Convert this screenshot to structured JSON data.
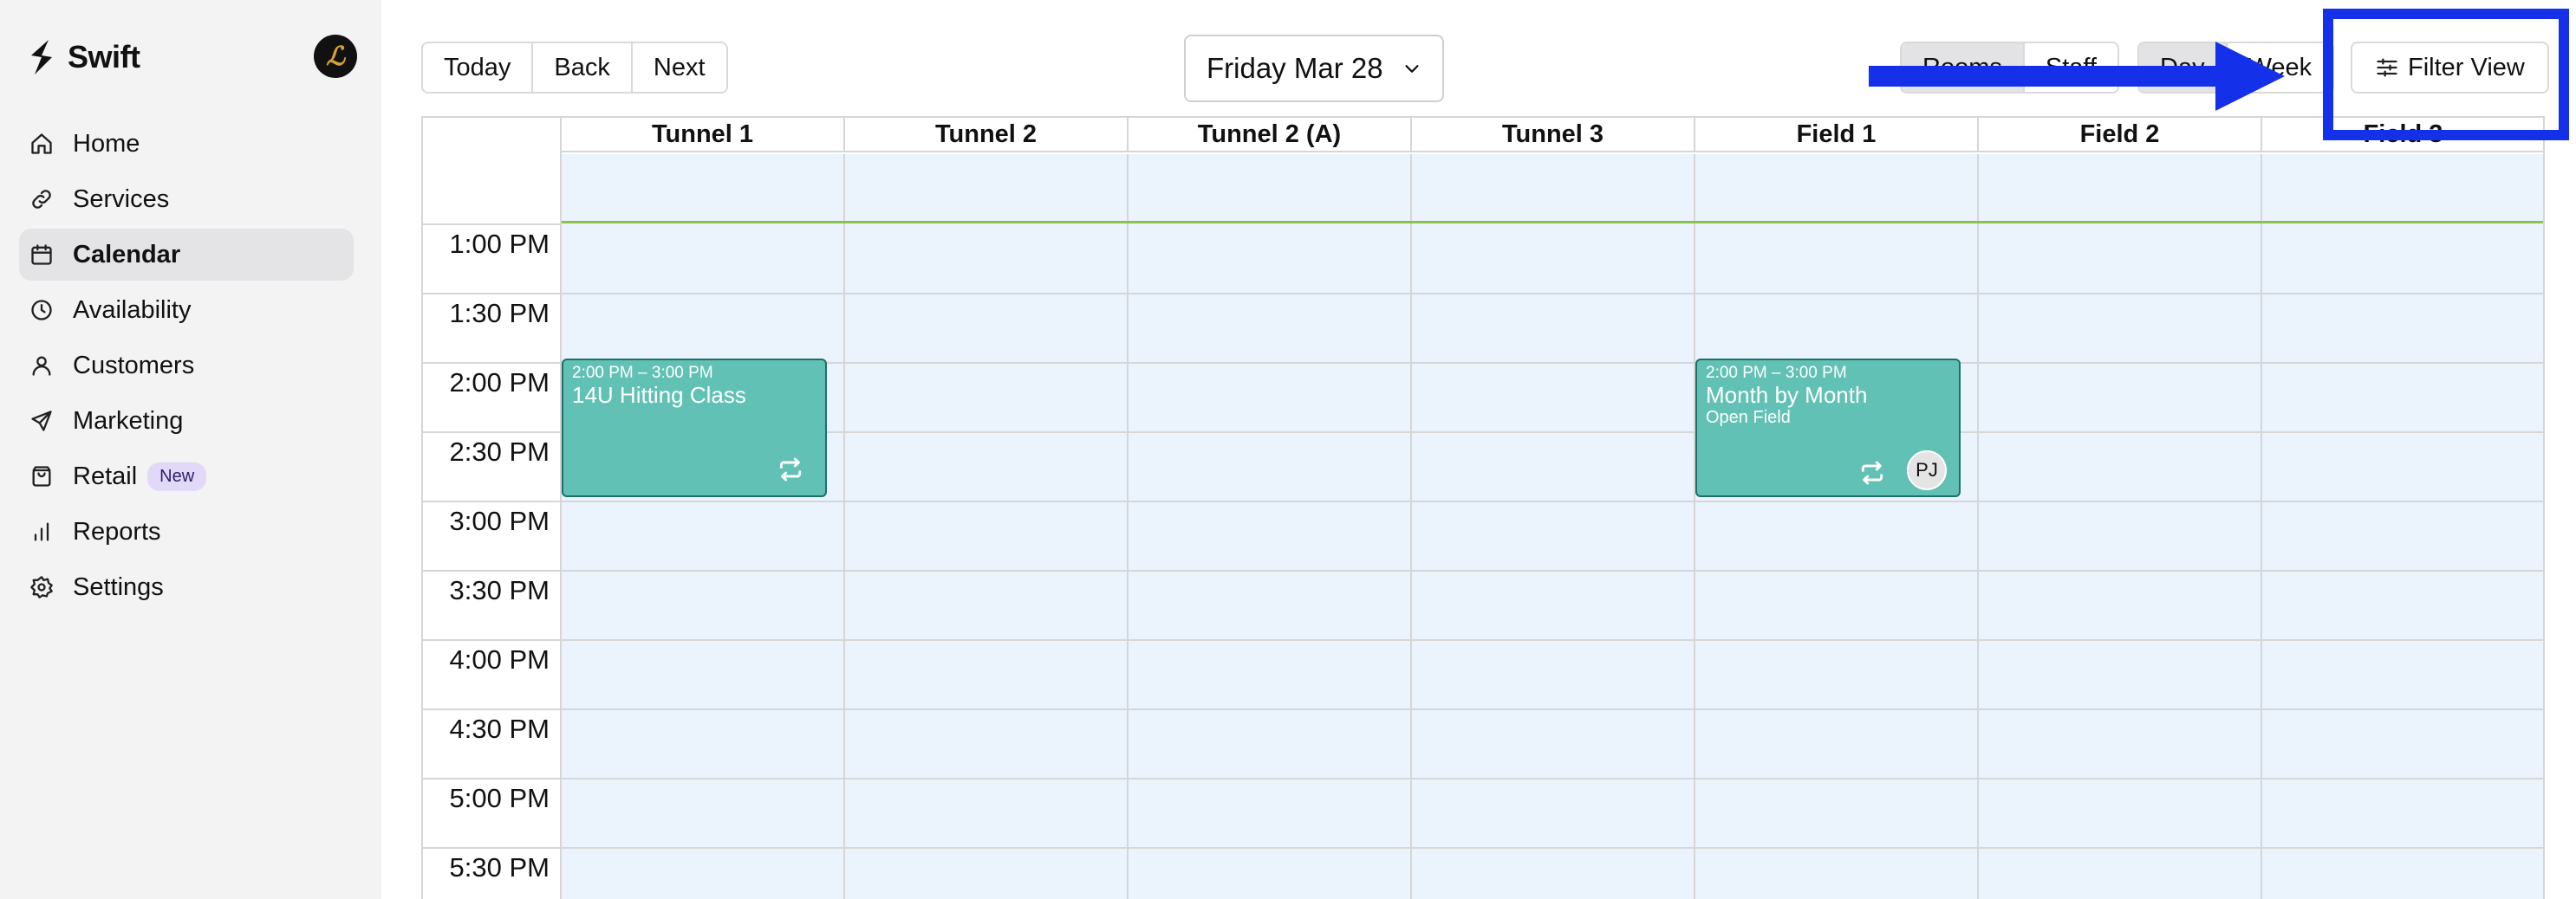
{
  "sidebar": {
    "brand": "Swift",
    "items": [
      {
        "label": "Home",
        "icon": "home-icon"
      },
      {
        "label": "Services",
        "icon": "link-icon"
      },
      {
        "label": "Calendar",
        "icon": "calendar-icon",
        "active": true
      },
      {
        "label": "Availability",
        "icon": "clock-icon"
      },
      {
        "label": "Customers",
        "icon": "user-icon"
      },
      {
        "label": "Marketing",
        "icon": "send-icon"
      },
      {
        "label": "Retail",
        "icon": "bag-icon",
        "badge": "New"
      },
      {
        "label": "Reports",
        "icon": "bar-chart-icon"
      },
      {
        "label": "Settings",
        "icon": "gear-icon"
      }
    ]
  },
  "toolbar": {
    "today": "Today",
    "back": "Back",
    "next": "Next",
    "date": "Friday Mar 28",
    "rooms": "Rooms",
    "staff": "Staff",
    "day": "Day",
    "week": "Week",
    "filter": "Filter View"
  },
  "columns": [
    "Tunnel 1",
    "Tunnel 2",
    "Tunnel 2 (A)",
    "Tunnel 3",
    "Field 1",
    "Field 2",
    "Field 3"
  ],
  "times": [
    "1:00 PM",
    "1:30 PM",
    "2:00 PM",
    "2:30 PM",
    "3:00 PM",
    "3:30 PM",
    "4:00 PM",
    "4:30 PM",
    "5:00 PM",
    "5:30 PM"
  ],
  "events": [
    {
      "time": "2:00 PM – 3:00 PM",
      "title": "14U Hitting Class",
      "subtitle": "",
      "column": 0
    },
    {
      "time": "2:00 PM – 3:00 PM",
      "title": "Month by Month",
      "subtitle": "Open Field",
      "column": 4,
      "staff": "PJ"
    }
  ],
  "colors": {
    "event": "#62c1b5",
    "grid": "#ebf4fd",
    "annotation": "#1430e8",
    "now_line": "#8bc34a"
  }
}
